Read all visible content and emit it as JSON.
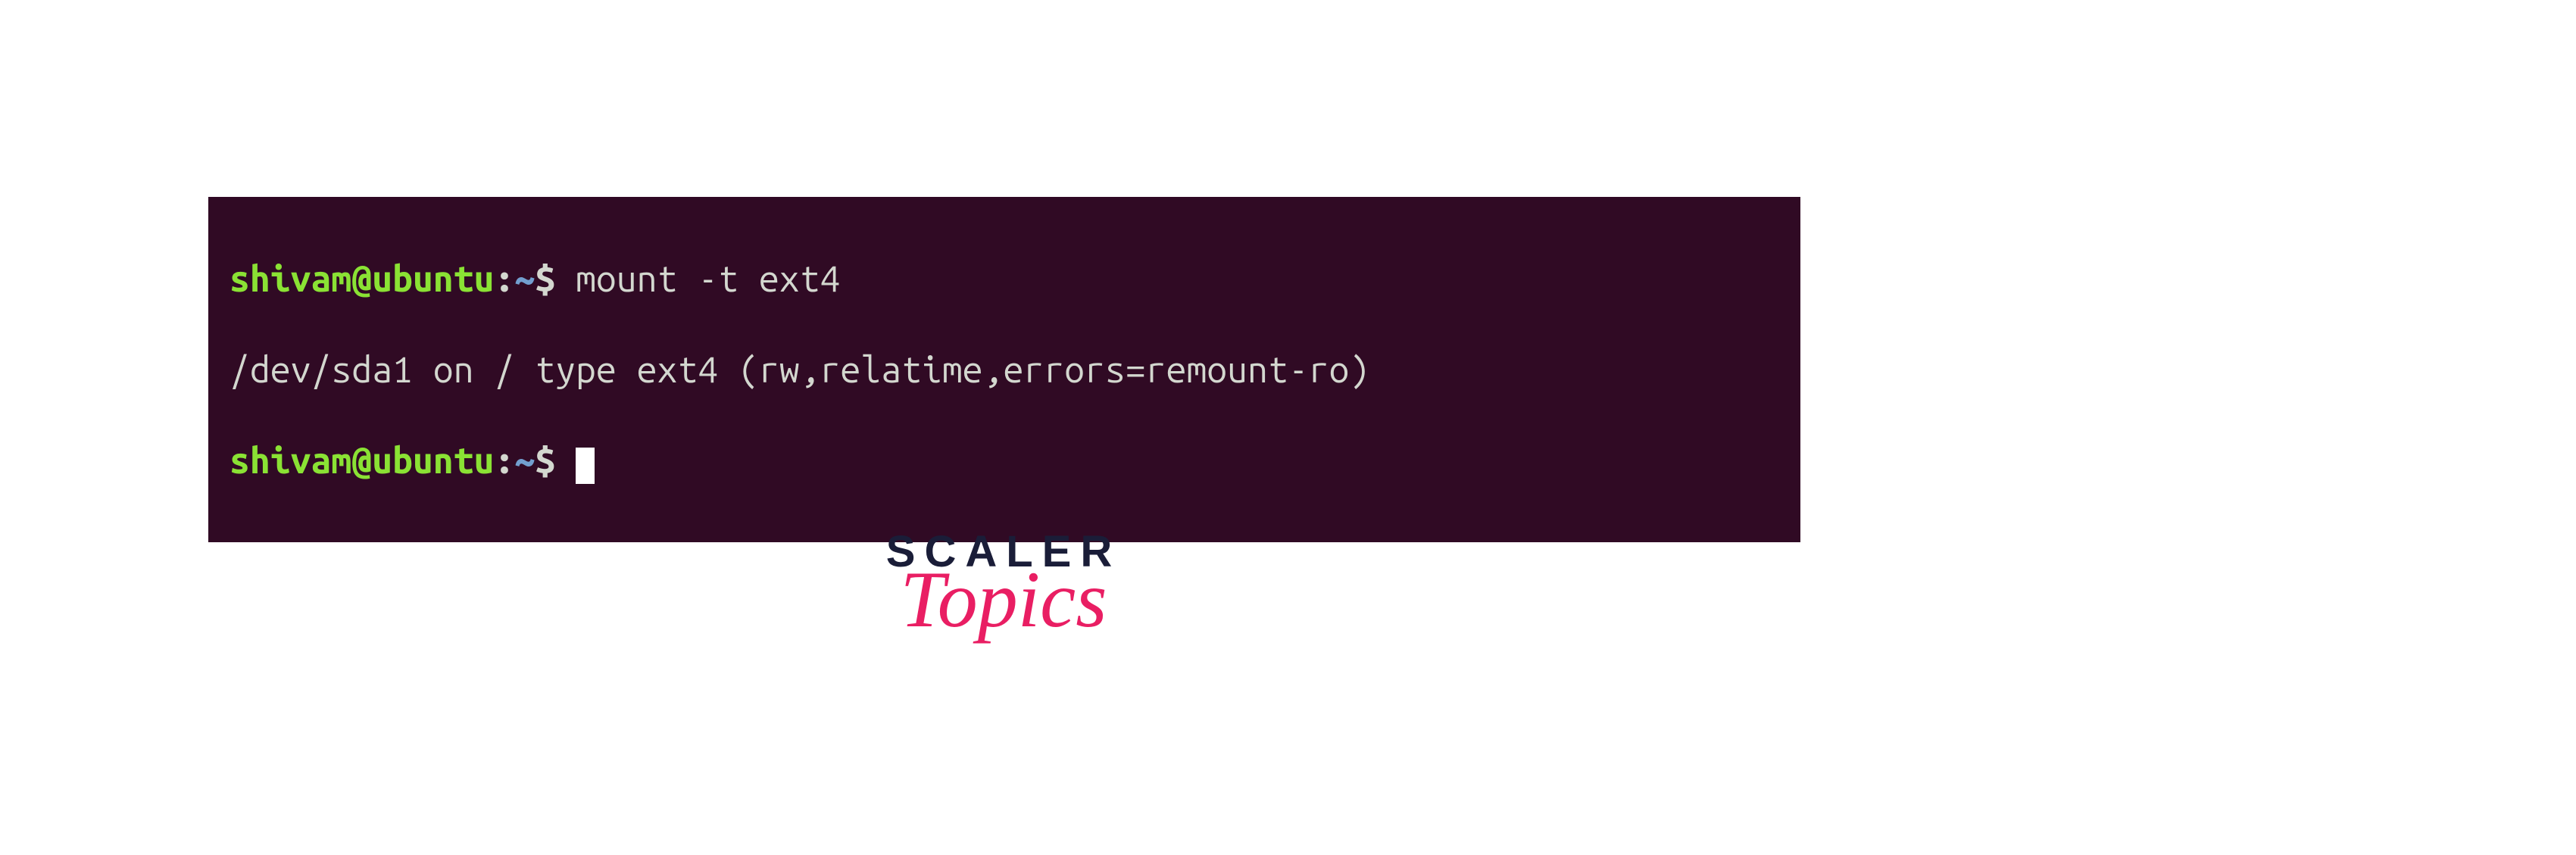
{
  "terminal": {
    "line1": {
      "user": "shivam@ubuntu",
      "colon": ":",
      "path": "~",
      "dollar": "$ ",
      "command": "mount -t ext4"
    },
    "line2": {
      "output": "/dev/sda1 on / type ext4 (rw,relatime,errors=remount-ro)"
    },
    "line3": {
      "user": "shivam@ubuntu",
      "colon": ":",
      "path": "~",
      "dollar": "$ "
    }
  },
  "logo": {
    "main": "SCALER",
    "sub": "Topics"
  }
}
